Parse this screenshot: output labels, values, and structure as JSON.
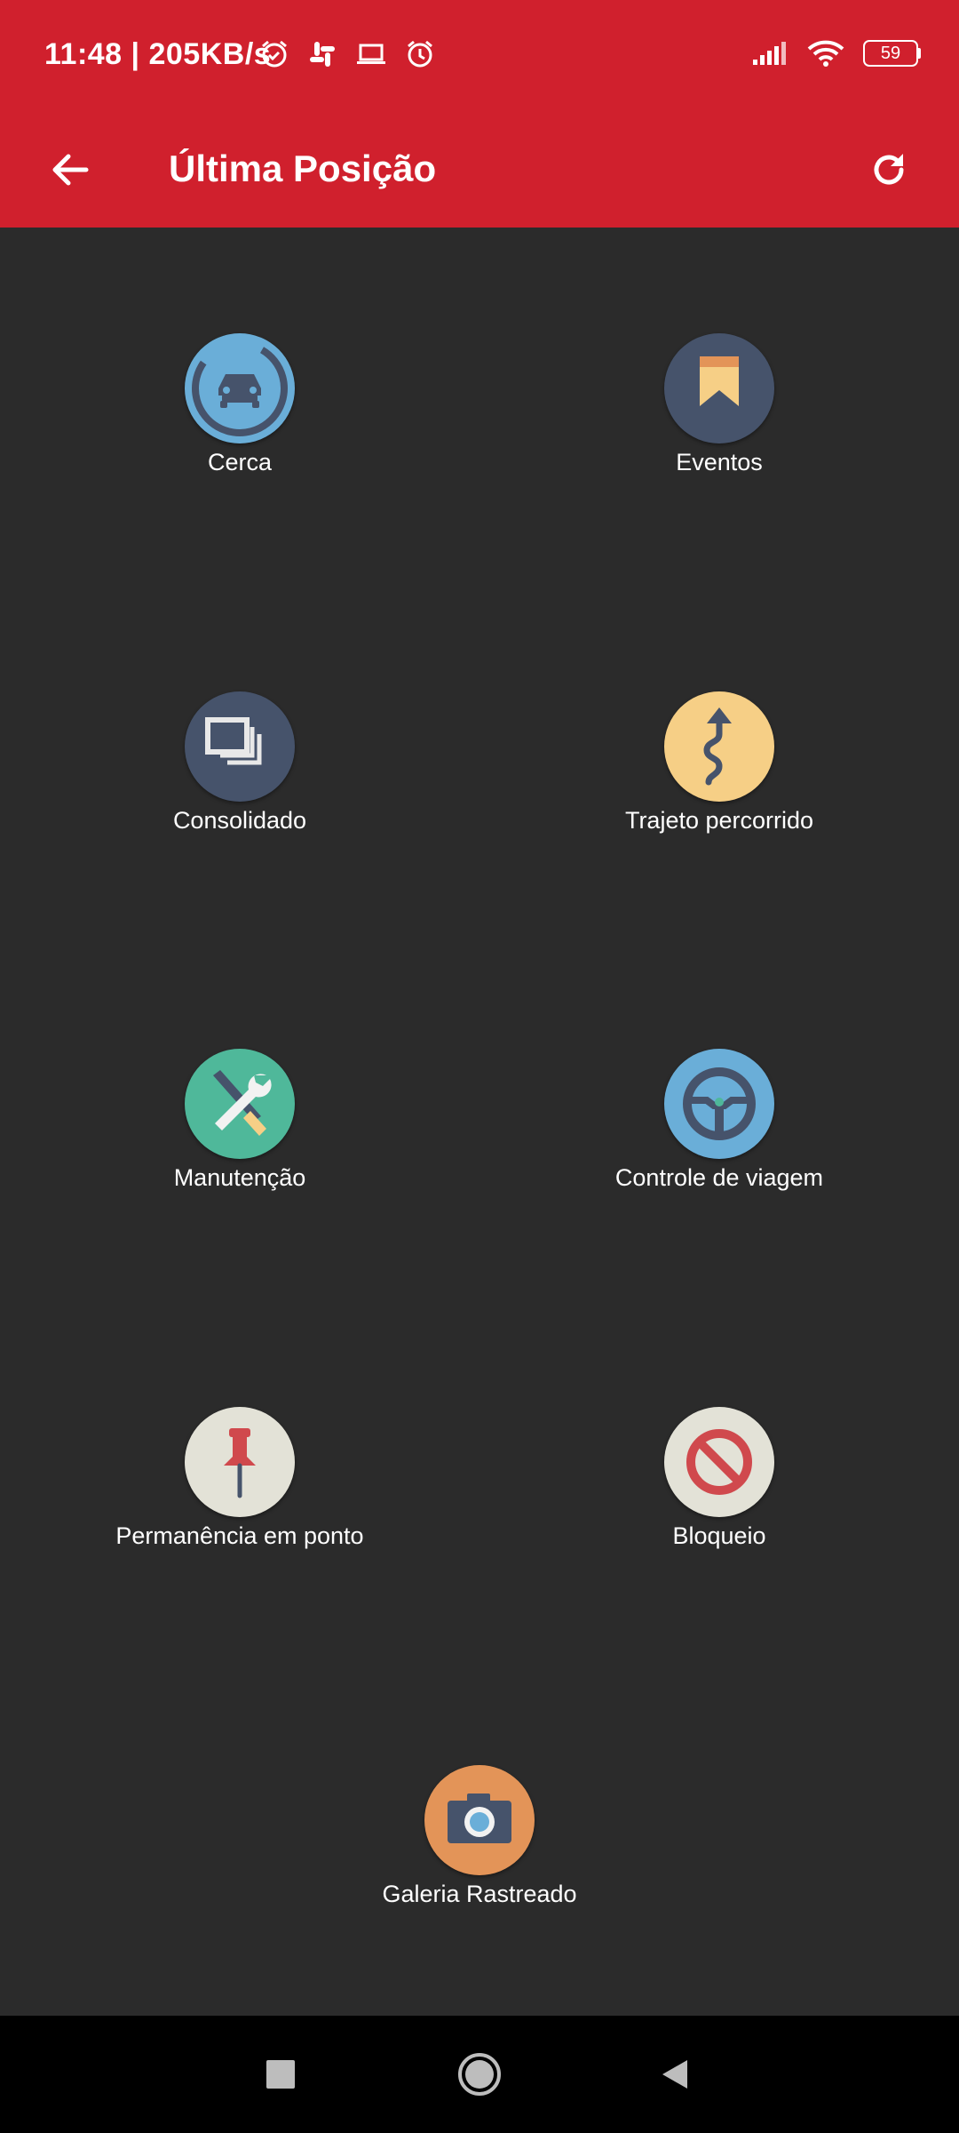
{
  "status_bar": {
    "time": "11:48 | 205KB/s",
    "battery": "59"
  },
  "app_bar": {
    "title": "Última Posição"
  },
  "menu": {
    "items": [
      {
        "label": "Cerca",
        "icon": "car-icon",
        "color": "#6aaed8"
      },
      {
        "label": "Eventos",
        "icon": "bookmark-icon",
        "color": "#46536b"
      },
      {
        "label": "Consolidado",
        "icon": "windows-stack-icon",
        "color": "#46536b"
      },
      {
        "label": "Trajeto percorrido",
        "icon": "route-arrow-icon",
        "color": "#f6cf86"
      },
      {
        "label": "Manutenção",
        "icon": "tools-icon",
        "color": "#4fb89a"
      },
      {
        "label": "Controle de viagem",
        "icon": "steering-wheel-icon",
        "color": "#6aaed8"
      },
      {
        "label": "Permanência em ponto",
        "icon": "pin-icon",
        "color": "#e3e2d7"
      },
      {
        "label": "Bloqueio",
        "icon": "block-icon",
        "color": "#e3e2d7"
      },
      {
        "label": "Galeria Rastreado",
        "icon": "camera-icon",
        "color": "#e39458"
      }
    ]
  },
  "colors": {
    "header": "#d0202d",
    "background": "#2b2b2b"
  }
}
